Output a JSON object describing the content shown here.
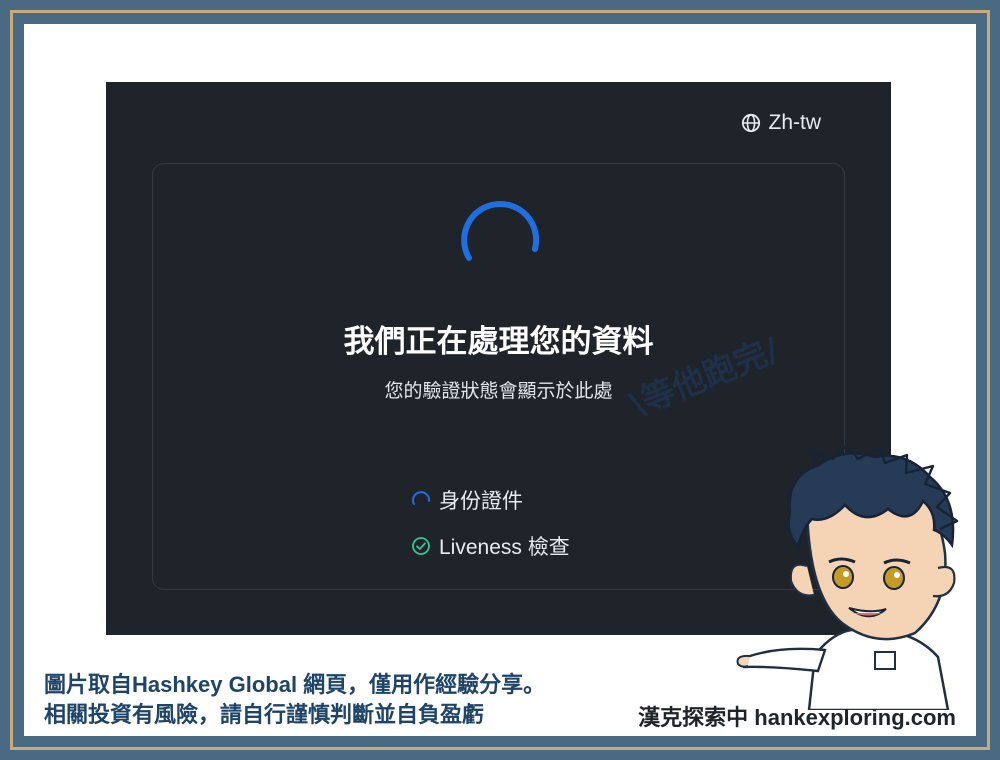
{
  "language": {
    "label": "Zh-tw",
    "icon": "globe-icon"
  },
  "status": {
    "title": "我們正在處理您的資料",
    "subtitle": "您的驗證狀態會顯示於此處",
    "spinner_color": "#1f6fe0"
  },
  "steps": [
    {
      "label": "身份證件",
      "state": "in-progress",
      "icon": "loading-icon"
    },
    {
      "label": "Liveness 檢查",
      "state": "done",
      "icon": "check-circle-icon"
    }
  ],
  "overlay": {
    "speech_text": "\\等他跑完/",
    "footer_line1": "圖片取自Hashkey Global 網頁，僅用作經驗分享。",
    "footer_line2": "相關投資有風險，請自行謹慎判斷並自負盈虧",
    "brand": "漢克探索中 hankexploring.com"
  },
  "colors": {
    "frame_outer": "#4a6a84",
    "frame_border": "#c9ab7a",
    "app_background": "#1f232a",
    "panel_border": "#343a44",
    "accent_blue": "#1f6fe0",
    "success_green": "#3ec28f",
    "footer_text": "#1e4468"
  }
}
